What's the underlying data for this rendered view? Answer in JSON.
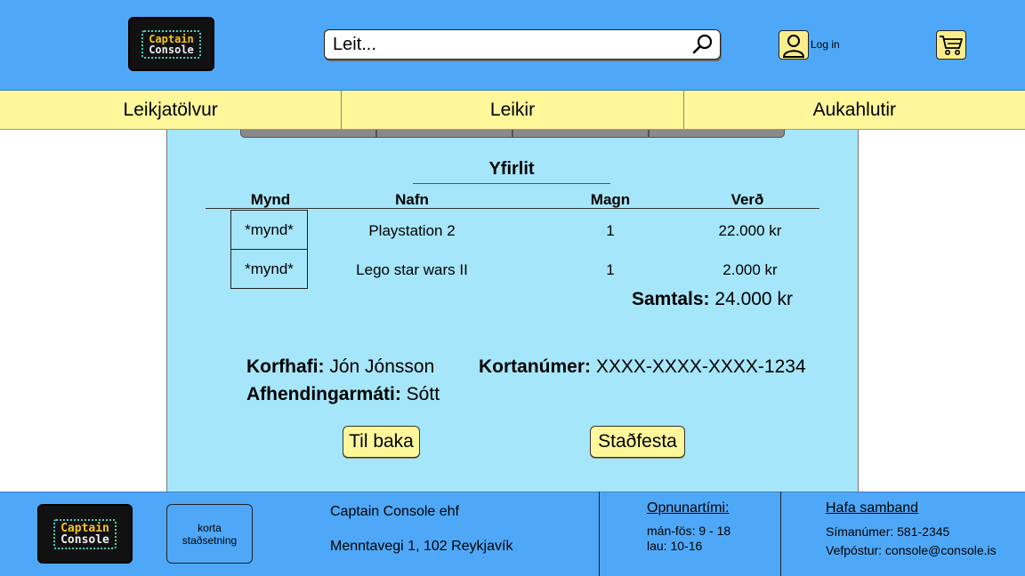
{
  "header": {
    "logo_line1": "Captain",
    "logo_line2": "Console",
    "search_placeholder": "Leit...",
    "search_icon": "magnifier-icon",
    "login_icon": "user-icon",
    "login_label": "Log in",
    "cart_icon": "cart-icon"
  },
  "nav": {
    "items": [
      "Leikjatölvur",
      "Leikir",
      "Aukahlutir"
    ]
  },
  "summary": {
    "title": "Yfirlit",
    "columns": [
      "Mynd",
      "Nafn",
      "Magn",
      "Verð"
    ],
    "rows": [
      {
        "image": "*mynd*",
        "name": "Playstation 2",
        "qty": "1",
        "price": "22.000 kr"
      },
      {
        "image": "*mynd*",
        "name": "Lego star wars II",
        "qty": "1",
        "price": "2.000 kr"
      }
    ],
    "total_label": "Samtals:",
    "total_value": " 24.000 kr"
  },
  "customer": {
    "owner_label": "Korfhafi:",
    "owner_value": " Jón Jónsson",
    "card_label": "Kortanúmer:",
    "card_value": " XXXX-XXXX-XXXX-1234",
    "delivery_label": "Afhendingarmáti:",
    "delivery_value": " Sótt"
  },
  "actions": {
    "back_label": "Til baka",
    "confirm_label": "Staðfesta"
  },
  "footer": {
    "logo_line1": "Captain",
    "logo_line2": "Console",
    "map_line1": "korta",
    "map_line2": "staðsetning",
    "company": "Captain Console ehf",
    "address": "Menntavegi 1, 102 Reykjavík",
    "hours_heading": "Opnunartími:",
    "hours_weekdays": "mán-fös: 9 - 18",
    "hours_saturday": "lau: 10-16",
    "contact_heading": "Hafa samband",
    "phone": "Símanúmer: 581-2345",
    "email": "Vefpóstur: console@console.is"
  },
  "colors": {
    "header_blue": "#4fa8f7",
    "nav_yellow": "#fff79a",
    "panel_blue": "#a6e6fa"
  }
}
